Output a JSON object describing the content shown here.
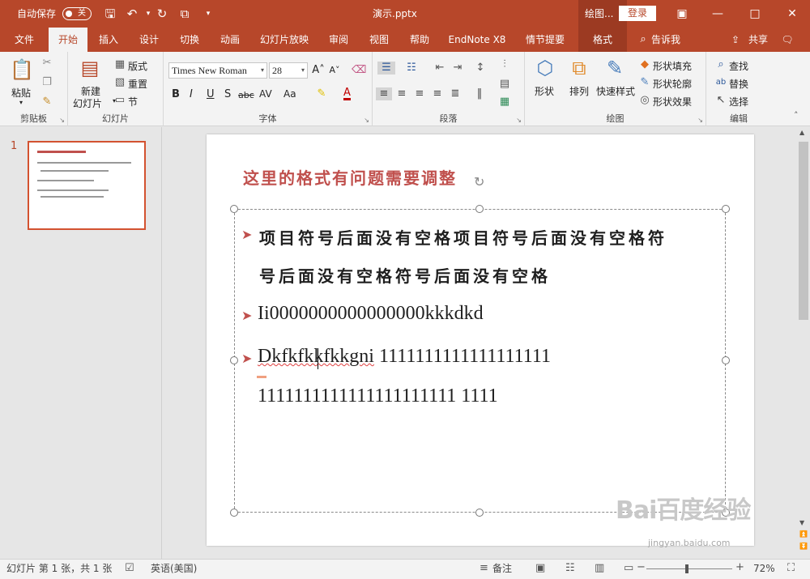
{
  "titlebar": {
    "autosave_label": "自动保存",
    "autosave_state": "关",
    "doc_title": "演示.pptx",
    "context_title": "绘图...",
    "login_label": "登录",
    "accent_color": "#b7472a"
  },
  "tabs": [
    {
      "label": "文件"
    },
    {
      "label": "开始"
    },
    {
      "label": "插入"
    },
    {
      "label": "设计"
    },
    {
      "label": "切换"
    },
    {
      "label": "动画"
    },
    {
      "label": "幻灯片放映"
    },
    {
      "label": "审阅"
    },
    {
      "label": "视图"
    },
    {
      "label": "帮助"
    },
    {
      "label": "EndNote X8"
    },
    {
      "label": "情节提要"
    },
    {
      "label": "格式"
    }
  ],
  "tellme": "告诉我",
  "share": "共享",
  "ribbon": {
    "clipboard": {
      "label": "剪贴板",
      "paste": "粘贴"
    },
    "slides": {
      "label": "幻灯片",
      "new_slide_1": "新建",
      "new_slide_2": "幻灯片",
      "layout": "版式",
      "reset": "重置",
      "section": "节"
    },
    "font": {
      "label": "字体",
      "font_name": "Times New Roman",
      "font_size": "28",
      "bold": "B",
      "italic": "I",
      "underline": "U",
      "shadow": "S",
      "strike": "abc",
      "spacing": "AV",
      "case": "Aa",
      "font_color": "A"
    },
    "paragraph": {
      "label": "段落"
    },
    "drawing": {
      "label": "绘图",
      "shapes": "形状",
      "arrange": "排列",
      "quick_styles": "快速样式",
      "fill": "形状填充",
      "outline": "形状轮廓",
      "effects": "形状效果"
    },
    "editing": {
      "label": "编辑",
      "find": "查找",
      "replace": "替换",
      "select": "选择"
    }
  },
  "thumbnail": {
    "number": "1"
  },
  "slide": {
    "title": "这里的格式有问题需要调整",
    "bullets": [
      {
        "line1": "项目符号后面没有空格项目符号后面没有空格符",
        "line2": "号后面没有空格符号后面没有空格"
      },
      {
        "line1": "Ii0000000000000000kkkdkd"
      },
      {
        "line1_word": "Dkfkfkkfkkgni",
        "line1_rest": " 1111111111111111111",
        "line2": "1111111111111111111111 1111"
      }
    ]
  },
  "statusbar": {
    "slide_info": "幻灯片 第 1 张，共 1 张",
    "language": "英语(美国)",
    "notes": "备注",
    "zoom": "72%"
  },
  "watermark": {
    "main": "Bai百度经验",
    "sub": "jingyan.baidu.com"
  }
}
